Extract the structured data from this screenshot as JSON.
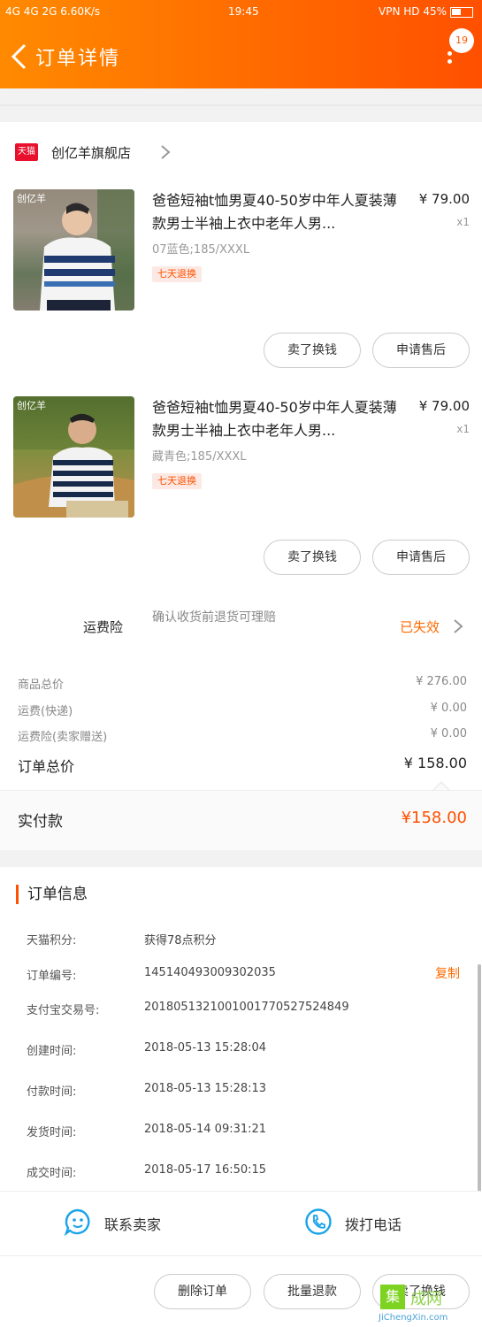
{
  "status_bar": {
    "left": "4G 4G 2G 6.60K/s",
    "time": "19:45",
    "right": "VPN HD 45%"
  },
  "header": {
    "title": "订单详情",
    "badge": "19"
  },
  "shop": {
    "name": "创亿羊旗舰店",
    "platform_logo": "天猫"
  },
  "products": [
    {
      "title": "爸爸短袖t恤男夏40-50岁中年人夏装薄款男士半袖上衣中老年人男...",
      "price": "¥ 79.00",
      "qty": "x1",
      "sku": "07蓝色;185/XXXL",
      "tag": "七天退换",
      "thumb_logo": "创亿羊",
      "buttons": [
        "卖了换钱",
        "申请售后"
      ]
    },
    {
      "title": "爸爸短袖t恤男夏40-50岁中年人夏装薄款男士半袖上衣中老年人男...",
      "price": "¥ 79.00",
      "qty": "x1",
      "sku": "藏青色;185/XXXL",
      "tag": "七天退换",
      "thumb_logo": "创亿羊",
      "buttons": [
        "卖了换钱",
        "申请售后"
      ]
    }
  ],
  "insurance": {
    "label": "运费险",
    "desc": "确认收货前退货可理赔",
    "status": "已失效"
  },
  "summary": [
    {
      "label": "商品总价",
      "value": "¥ 276.00"
    },
    {
      "label": "运费(快递)",
      "value": "¥ 0.00"
    },
    {
      "label": "运费险(卖家赠送)",
      "value": "¥ 0.00"
    }
  ],
  "order_total": {
    "label": "订单总价",
    "value": "¥ 158.00"
  },
  "paid": {
    "label": "实付款",
    "value": "¥158.00"
  },
  "order_info": {
    "title": "订单信息",
    "copy_label": "复制",
    "rows": [
      {
        "label": "天猫积分:",
        "value": "获得78点积分"
      },
      {
        "label": "订单编号:",
        "value": "145140493009302035"
      },
      {
        "label": "支付宝交易号:",
        "value": "2018051321001001770527524849"
      },
      {
        "label": "创建时间:",
        "value": "2018-05-13 15:28:04"
      },
      {
        "label": "付款时间:",
        "value": "2018-05-13 15:28:13"
      },
      {
        "label": "发货时间:",
        "value": "2018-05-14 09:31:21"
      },
      {
        "label": "成交时间:",
        "value": "2018-05-17 16:50:15"
      }
    ]
  },
  "contact": {
    "seller": "联系卖家",
    "phone": "拨打电话"
  },
  "bottom": {
    "delete": "删除订单",
    "batch_refund": "批量退款",
    "sell": "卖了换钱"
  },
  "watermark": {
    "mark": "集",
    "text": "成网",
    "url": "JiChengXin.com"
  },
  "colors": {
    "accent": "#ff5000",
    "header_start": "#ff8a00",
    "contact_icon": "#1aa3e8"
  }
}
